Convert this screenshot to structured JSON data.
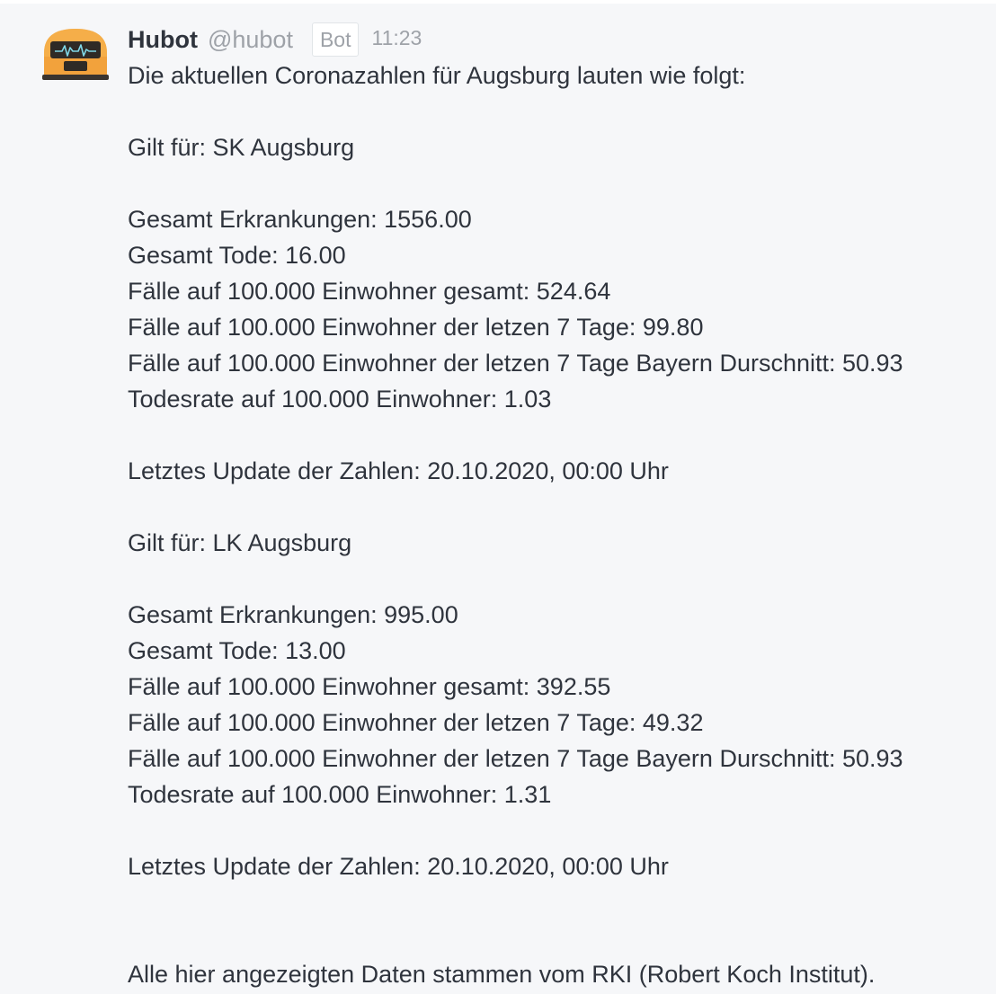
{
  "message": {
    "author": {
      "name": "Hubot",
      "handle": "@hubot",
      "badge": "Bot",
      "avatar_icon": "robot-avatar-icon",
      "avatar_color": "#f2a23c"
    },
    "time": "11:23",
    "intro": "Die aktuellen Coronazahlen für Augsburg lauten wie folgt:",
    "sections": [
      {
        "applies_to": "Gilt für: SK Augsburg",
        "lines": [
          "Gesamt Erkrankungen: 1556.00",
          "Gesamt Tode: 16.00",
          "Fälle auf 100.000 Einwohner gesamt: 524.64",
          "Fälle auf 100.000 Einwohner der letzen 7 Tage: 99.80",
          "Fälle auf 100.000 Einwohner der letzen 7 Tage Bayern Durschnitt: 50.93",
          "Todesrate auf 100.000 Einwohner: 1.03"
        ],
        "last_update": "Letztes Update der Zahlen: 20.10.2020, 00:00 Uhr"
      },
      {
        "applies_to": "Gilt für: LK Augsburg",
        "lines": [
          "Gesamt Erkrankungen: 995.00",
          "Gesamt Tode: 13.00",
          "Fälle auf 100.000 Einwohner gesamt: 392.55",
          "Fälle auf 100.000 Einwohner der letzen 7 Tage: 49.32",
          "Fälle auf 100.000 Einwohner der letzen 7 Tage Bayern Durschnitt: 50.93",
          "Todesrate auf 100.000 Einwohner: 1.31"
        ],
        "last_update": "Letztes Update der Zahlen: 20.10.2020, 00:00 Uhr"
      }
    ],
    "footer": "Alle hier angezeigten Daten stammen vom RKI (Robert Koch Institut)."
  }
}
